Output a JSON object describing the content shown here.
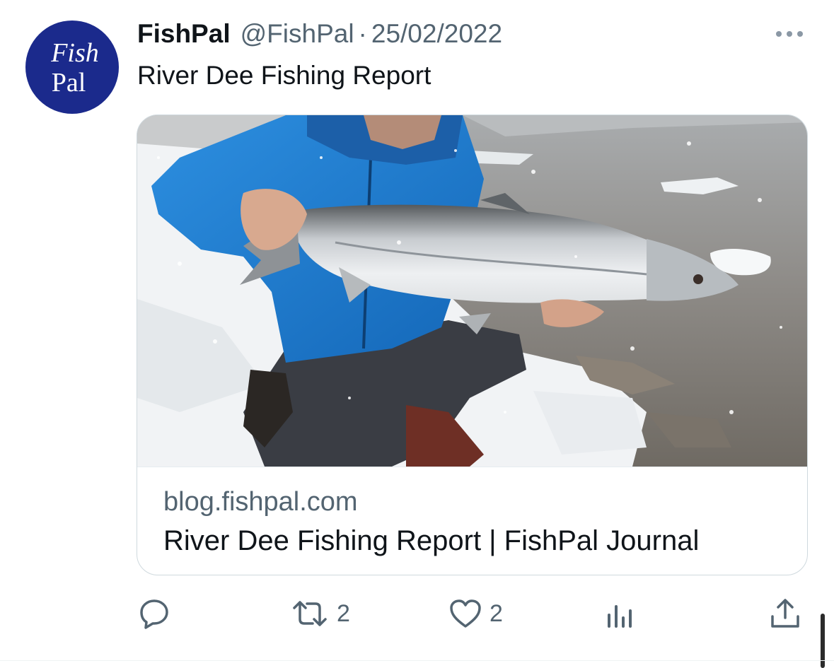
{
  "author": {
    "avatar_top": "Fish",
    "avatar_bottom": "Pal",
    "display_name": "FishPal",
    "handle": "@FishPal",
    "separator": "·",
    "date": "25/02/2022"
  },
  "tweet": {
    "text": "River Dee Fishing Report"
  },
  "card": {
    "domain": "blog.fishpal.com",
    "title": "River Dee Fishing Report | FishPal Journal"
  },
  "actions": {
    "reply_count": "",
    "retweet_count": "2",
    "like_count": "2",
    "views_count": ""
  },
  "icons": {
    "more": "more-icon",
    "reply": "reply-icon",
    "retweet": "retweet-icon",
    "like": "heart-icon",
    "views": "views-icon",
    "share": "share-icon"
  },
  "colors": {
    "avatar_bg": "#1b2a8c",
    "secondary_text": "#536471",
    "primary_text": "#0f1419",
    "border": "#cfd9de"
  }
}
